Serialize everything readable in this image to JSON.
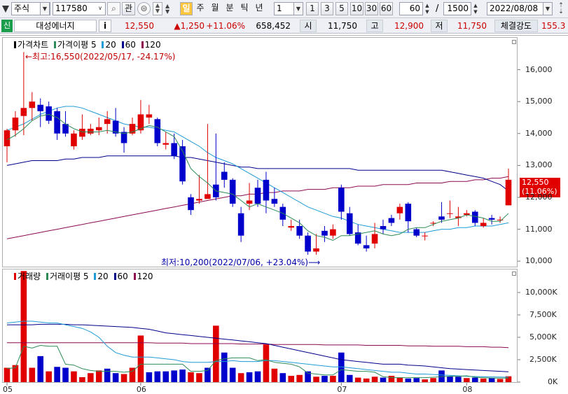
{
  "toolbar": {
    "market": "주식",
    "code": "117580",
    "watch_label": "관",
    "period_buttons": [
      "일",
      "주",
      "월",
      "분",
      "틱",
      "년"
    ],
    "period_active": "일",
    "interval_value": "1",
    "quick_intervals": [
      "1",
      "3",
      "5",
      "10",
      "30",
      "60"
    ],
    "count_value": "60",
    "count_total": "1500",
    "slash": "/",
    "date": "2022/08/08"
  },
  "quote": {
    "badge": "신",
    "name": "대성에너지",
    "info": "i",
    "price": "12,550",
    "change": "▲1,250",
    "change_pct": "+11.06%",
    "volume": "658,452",
    "open_label": "시",
    "open": "11,750",
    "high_label": "고",
    "high": "12,900",
    "low_label": "저",
    "low": "11,750",
    "strength_label": "체결강도",
    "strength": "155.3"
  },
  "price_chart": {
    "legend": [
      {
        "text": "가격차트",
        "color": "#000000"
      },
      {
        "text": "가격이평 5",
        "color": "#2e8b57"
      },
      {
        "text": "20",
        "color": "#1f9bd6"
      },
      {
        "text": "60",
        "color": "#00008b"
      },
      {
        "text": "120",
        "color": "#8b0a50"
      }
    ],
    "high_annotation": "←최고:16,550(2022/05/17, -24.17%)",
    "low_annotation": "최저:10,200(2022/07/06, +23.04%)⟶",
    "last_price_tag": "12,550",
    "last_pct_tag": "(11.06%)"
  },
  "volume_chart": {
    "legend": [
      {
        "text": "거래량",
        "color": "#000000"
      },
      {
        "text": "거래이평 5",
        "color": "#2e8b57"
      },
      {
        "text": "20",
        "color": "#1f9bd6"
      },
      {
        "text": "60",
        "color": "#00008b"
      },
      {
        "text": "120",
        "color": "#8b0a50"
      }
    ]
  },
  "chart_data": [
    {
      "type": "candlestick",
      "up_color": "#e00000",
      "down_color": "#0000cc",
      "yticks": [
        10000,
        11000,
        12000,
        13000,
        14000,
        15000,
        16000
      ],
      "ytick_labels": [
        "10,000",
        "11,000",
        "12,000",
        "13,000",
        "14,000",
        "15,000",
        "16,000"
      ],
      "ylim": [
        9850,
        17000
      ],
      "xtick_labels": [
        "05",
        "06",
        "07",
        "08"
      ],
      "candles": [
        [
          13600,
          14100,
          13100,
          14150
        ],
        [
          14100,
          14500,
          13900,
          14700
        ],
        [
          14550,
          14800,
          13950,
          16550
        ],
        [
          14800,
          15000,
          14400,
          15300
        ],
        [
          14900,
          14700,
          14200,
          15100
        ],
        [
          14850,
          14400,
          14300,
          15000
        ],
        [
          14700,
          14000,
          13800,
          14800
        ],
        [
          14300,
          14000,
          13900,
          14700
        ],
        [
          13600,
          14000,
          13500,
          14100
        ],
        [
          13900,
          14150,
          13800,
          14600
        ],
        [
          14000,
          14150,
          13950,
          14300
        ],
        [
          14100,
          14200,
          13950,
          14500
        ],
        [
          14300,
          14450,
          14000,
          14700
        ],
        [
          14400,
          14000,
          13900,
          14800
        ],
        [
          14050,
          13700,
          13400,
          14200
        ],
        [
          14000,
          14300,
          13950,
          14500
        ],
        [
          14100,
          14600,
          14000,
          15050
        ],
        [
          14500,
          14600,
          14300,
          14900
        ],
        [
          14450,
          13700,
          13600,
          14500
        ],
        [
          13650,
          13700,
          13500,
          14050
        ],
        [
          13700,
          13300,
          13200,
          14000
        ],
        [
          13600,
          12500,
          12400,
          13800
        ],
        [
          12000,
          11600,
          11450,
          12100
        ],
        [
          11900,
          11950,
          11800,
          12700
        ],
        [
          11950,
          12100,
          11950,
          14300
        ],
        [
          12400,
          12000,
          11900,
          14000
        ],
        [
          12800,
          12550,
          12300,
          13100
        ],
        [
          12550,
          11800,
          11700,
          12600
        ],
        [
          11500,
          10800,
          10600,
          11700
        ],
        [
          11800,
          11900,
          11600,
          12450
        ],
        [
          12300,
          11800,
          11700,
          12550
        ],
        [
          12550,
          11900,
          11500,
          12800
        ],
        [
          11950,
          11800,
          11700,
          12300
        ],
        [
          11700,
          11300,
          11100,
          11800
        ],
        [
          11050,
          11100,
          10950,
          11300
        ],
        [
          11100,
          10800,
          10700,
          11300
        ],
        [
          10800,
          10300,
          10200,
          10900
        ],
        [
          10300,
          10400,
          10200,
          10850
        ],
        [
          10950,
          10800,
          10600,
          11100
        ],
        [
          10800,
          11000,
          10700,
          11150
        ],
        [
          12300,
          11550,
          11300,
          12400
        ],
        [
          11500,
          10850,
          10800,
          11700
        ],
        [
          10900,
          10550,
          10500,
          11150
        ],
        [
          10500,
          10400,
          10300,
          10800
        ],
        [
          10550,
          10850,
          10400,
          11200
        ],
        [
          11100,
          11000,
          10850,
          11300
        ],
        [
          11350,
          11200,
          11100,
          11450
        ],
        [
          11500,
          11700,
          11300,
          11800
        ],
        [
          11800,
          11250,
          10900,
          11850
        ],
        [
          11000,
          10800,
          10750,
          11050
        ],
        [
          10800,
          10800,
          10650,
          10900
        ],
        [
          11200,
          11200,
          11100,
          11250
        ],
        [
          11400,
          11300,
          11200,
          11850
        ],
        [
          11500,
          11500,
          11350,
          11900
        ],
        [
          11350,
          11400,
          11100,
          11700
        ],
        [
          11450,
          11500,
          11400,
          11600
        ],
        [
          11550,
          11200,
          11100,
          11600
        ],
        [
          11100,
          11200,
          11050,
          11350
        ],
        [
          11350,
          11300,
          11150,
          11450
        ],
        [
          11300,
          11300,
          11200,
          11400
        ],
        [
          11750,
          12550,
          11750,
          12900
        ]
      ],
      "ma5": [
        13800,
        13950,
        14150,
        14400,
        14550,
        14600,
        14500,
        14300,
        14150,
        14050,
        14050,
        14050,
        14100,
        14050,
        14000,
        14050,
        14150,
        14250,
        14200,
        14050,
        13900,
        13450,
        12900,
        12650,
        12450,
        12200,
        12150,
        12100,
        11900,
        11700,
        11800,
        11700,
        11600,
        11500,
        11350,
        11200,
        10950,
        10800,
        10750,
        10650,
        10800,
        10800,
        10850,
        10900,
        10950,
        10850,
        10800,
        10850,
        11000,
        11050,
        11050,
        11150,
        11250,
        11300,
        11350,
        11450,
        11400,
        11350,
        11250,
        11250,
        11500
      ],
      "ma20": [
        14100,
        14200,
        14300,
        14450,
        14600,
        14700,
        14800,
        14850,
        14850,
        14800,
        14700,
        14600,
        14500,
        14400,
        14300,
        14250,
        14200,
        14200,
        14150,
        14100,
        14050,
        13900,
        13750,
        13600,
        13400,
        13250,
        13150,
        13050,
        12900,
        12750,
        12600,
        12450,
        12300,
        12150,
        12000,
        11850,
        11700,
        11600,
        11500,
        11400,
        11350,
        11250,
        11150,
        11100,
        11050,
        11000,
        10950,
        10900,
        10900,
        10900,
        10900,
        10950,
        11000,
        11000,
        11050,
        11050,
        11100,
        11100,
        11100,
        11150,
        11200
      ],
      "ma60": [
        13000,
        13050,
        13100,
        13150,
        13150,
        13150,
        13150,
        13200,
        13200,
        13250,
        13250,
        13250,
        13300,
        13300,
        13300,
        13300,
        13300,
        13300,
        13300,
        13300,
        13300,
        13250,
        13250,
        13200,
        13150,
        13100,
        13050,
        13000,
        12950,
        12950,
        12900,
        12900,
        12900,
        12900,
        12900,
        12900,
        12900,
        12900,
        12900,
        12900,
        12900,
        12900,
        12850,
        12850,
        12850,
        12850,
        12850,
        12850,
        12850,
        12850,
        12850,
        12850,
        12850,
        12800,
        12750,
        12700,
        12650,
        12600,
        12500,
        12400,
        12200
      ],
      "ma120": [
        10700,
        10750,
        10800,
        10850,
        10900,
        10950,
        11000,
        11050,
        11100,
        11150,
        11200,
        11250,
        11300,
        11350,
        11400,
        11450,
        11500,
        11550,
        11600,
        11650,
        11700,
        11750,
        11800,
        11850,
        11900,
        11950,
        12000,
        12050,
        12050,
        12100,
        12100,
        12150,
        12150,
        12200,
        12200,
        12200,
        12250,
        12250,
        12250,
        12300,
        12300,
        12300,
        12350,
        12350,
        12350,
        12400,
        12400,
        12400,
        12400,
        12450,
        12450,
        12450,
        12450,
        12500,
        12500,
        12500,
        12550,
        12550,
        12600,
        12600,
        12650
      ]
    },
    {
      "type": "bar",
      "title": "거래량",
      "yticks": [
        0,
        2500,
        5000,
        7500,
        10000
      ],
      "ytick_labels": [
        "0K",
        "2,500K",
        "5,000K",
        "7,500K",
        "10,000K"
      ],
      "ylim": [
        0,
        12500
      ],
      "values": [
        1600,
        1900,
        12400,
        1600,
        2900,
        1200,
        1700,
        1600,
        1200,
        550,
        1000,
        1300,
        1500,
        1000,
        900,
        1600,
        5200,
        1100,
        1200,
        1200,
        1300,
        1400,
        1100,
        1000,
        1600,
        6300,
        3300,
        1600,
        1000,
        1100,
        1200,
        4200,
        1500,
        1000,
        700,
        800,
        1200,
        600,
        700,
        700,
        3300,
        800,
        500,
        400,
        600,
        500,
        700,
        500,
        400,
        450,
        300,
        450,
        1300,
        650,
        600,
        450,
        500,
        400,
        450,
        350,
        650
      ],
      "bar_colors": [
        "up",
        "up",
        "up",
        "up",
        "down",
        "up",
        "down",
        "down",
        "up",
        "up",
        "up",
        "up",
        "down",
        "down",
        "up",
        "up",
        "up",
        "down",
        "down",
        "down",
        "down",
        "down",
        "up",
        "up",
        "down",
        "up",
        "down",
        "down",
        "up",
        "down",
        "down",
        "up",
        "up",
        "down",
        "up",
        "up",
        "down",
        "up",
        "down",
        "up",
        "down",
        "down",
        "up",
        "up",
        "up",
        "down",
        "up",
        "up",
        "down",
        "down",
        "up",
        "up",
        "down",
        "down",
        "down",
        "up",
        "down",
        "up",
        "down",
        "up",
        "up"
      ],
      "ma5": [
        1500,
        1600,
        4000,
        3800,
        4100,
        4000,
        4000,
        2000,
        1900,
        1500,
        1300,
        1200,
        1200,
        1200,
        1100,
        1200,
        2000,
        2000,
        2000,
        2000,
        2000,
        2000,
        1200,
        1200,
        1300,
        2400,
        2600,
        2700,
        2700,
        2700,
        2400,
        2500,
        2200,
        2100,
        2000,
        1700,
        1000,
        900,
        800,
        800,
        1400,
        1300,
        1200,
        1200,
        1100,
        600,
        500,
        500,
        500,
        500,
        500,
        550,
        600,
        650,
        650,
        700,
        550,
        500,
        450,
        450,
        450
      ],
      "ma20": [
        6600,
        6700,
        6800,
        6800,
        6700,
        6600,
        6600,
        6400,
        6200,
        6000,
        5600,
        5000,
        4000,
        3300,
        3000,
        2800,
        2800,
        2800,
        2700,
        2600,
        2500,
        2300,
        2200,
        2200,
        2200,
        2300,
        2300,
        2400,
        2300,
        2300,
        2300,
        2400,
        2400,
        2300,
        2200,
        2100,
        2000,
        1900,
        1800,
        1700,
        1700,
        1600,
        1500,
        1400,
        1300,
        1200,
        1100,
        1100,
        1000,
        900,
        900,
        850,
        800,
        750,
        700,
        650,
        620,
        600,
        580,
        560,
        550
      ],
      "ma60": [
        6400,
        6400,
        6400,
        6400,
        6450,
        6450,
        6450,
        6450,
        6400,
        6400,
        6350,
        6300,
        6250,
        6200,
        6150,
        6100,
        6000,
        5900,
        5700,
        5500,
        5400,
        5300,
        5200,
        5100,
        5000,
        4900,
        4800,
        4700,
        4600,
        4500,
        4400,
        4300,
        4100,
        3900,
        3700,
        3500,
        3300,
        3100,
        2900,
        2700,
        2500,
        2400,
        2300,
        2200,
        2100,
        2000,
        2000,
        2000,
        1900,
        1850,
        1800,
        1700,
        1600,
        1500,
        1450,
        1400,
        1350,
        1300,
        1250,
        1200,
        1150
      ],
      "ma120": [
        4400,
        4400,
        4400,
        4400,
        4400,
        4400,
        4400,
        4400,
        4400,
        4400,
        4400,
        4400,
        4400,
        4400,
        4400,
        4400,
        4400,
        4400,
        4350,
        4350,
        4350,
        4350,
        4300,
        4300,
        4300,
        4300,
        4300,
        4300,
        4250,
        4250,
        4250,
        4250,
        4200,
        4200,
        4200,
        4200,
        4200,
        4200,
        4150,
        4150,
        4150,
        4150,
        4150,
        4100,
        4100,
        4100,
        4100,
        4100,
        4050,
        4050,
        4050,
        4000,
        4000,
        4000,
        4000,
        3950,
        3950,
        3950,
        3900,
        3900,
        3850
      ]
    }
  ]
}
